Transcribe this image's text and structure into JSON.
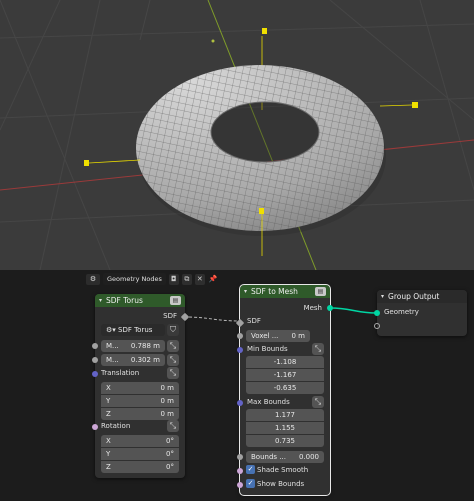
{
  "viewport": {
    "name": "3D Viewport"
  },
  "node_editor": {
    "tree_selector": {
      "icon": "node-tree-icon",
      "name": "Geometry Nodes",
      "pin_icon": "pin-icon"
    },
    "sdf_torus": {
      "title": "SDF Torus",
      "output_sdf": "SDF",
      "mode": "SDF Torus",
      "major_label": "M...",
      "major_value": "0.788 m",
      "minor_label": "M...",
      "minor_value": "0.302 m",
      "translation_label": "Translation",
      "translation": [
        {
          "axis": "X",
          "value": "0 m"
        },
        {
          "axis": "Y",
          "value": "0 m"
        },
        {
          "axis": "Z",
          "value": "0 m"
        }
      ],
      "rotation_label": "Rotation",
      "rotation": [
        {
          "axis": "X",
          "value": "0°"
        },
        {
          "axis": "Y",
          "value": "0°"
        },
        {
          "axis": "Z",
          "value": "0°"
        }
      ]
    },
    "sdf_to_mesh": {
      "title": "SDF to Mesh",
      "output_mesh": "Mesh",
      "input_sdf": "SDF",
      "voxel_label": "Voxel ...",
      "voxel_value": "0 m",
      "min_bounds_label": "Min Bounds",
      "min_bounds": [
        "-1.108",
        "-1.167",
        "-0.635"
      ],
      "max_bounds_label": "Max Bounds",
      "max_bounds": [
        "1.177",
        "1.155",
        "0.735"
      ],
      "bounds_pad_label": "Bounds ...",
      "bounds_pad_value": "0.000",
      "shade_smooth_label": "Shade Smooth",
      "show_bounds_label": "Show Bounds"
    },
    "group_output": {
      "title": "Group Output",
      "input_geometry": "Geometry"
    }
  },
  "colors": {
    "viewport_bg": "#3b3b3b",
    "grid_line": "#454545",
    "axis_red": "#9a3a3a",
    "axis_yellow_green": "#7f9c2a",
    "empty_yellow": "#f0e000",
    "torus_surface": "#9c9c9c",
    "node_header_green": "#2f5a2a",
    "socket_grey": "#a1a1a1",
    "socket_purple": "#6363c7",
    "socket_teal": "#00d6a3"
  }
}
